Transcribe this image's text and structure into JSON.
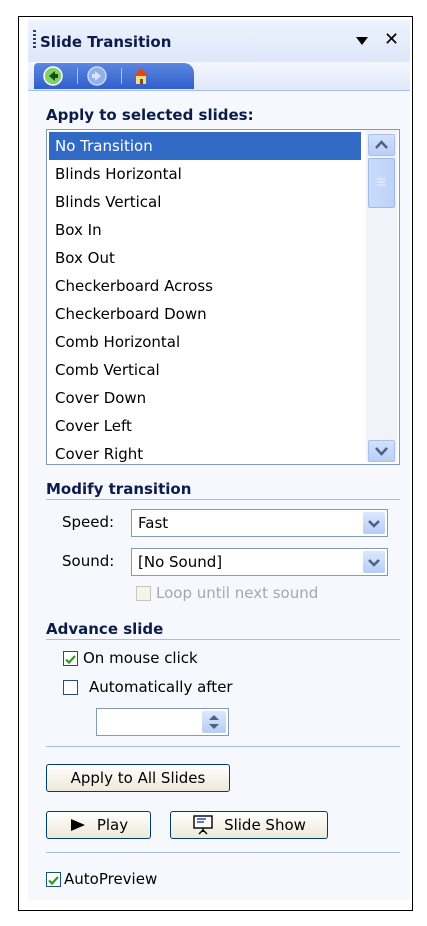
{
  "pane": {
    "title": "Slide Transition"
  },
  "apply_section": {
    "heading": "Apply to selected slides:",
    "items": [
      "No Transition",
      "Blinds Horizontal",
      "Blinds Vertical",
      "Box In",
      "Box Out",
      "Checkerboard Across",
      "Checkerboard Down",
      "Comb Horizontal",
      "Comb Vertical",
      "Cover Down",
      "Cover Left",
      "Cover Right"
    ],
    "selected": "No Transition"
  },
  "modify": {
    "heading": "Modify transition",
    "speed_label": "Speed:",
    "speed_value": "Fast",
    "sound_label": "Sound:",
    "sound_value": "[No Sound]",
    "loop_label": "Loop until next sound",
    "loop_checked": false
  },
  "advance": {
    "heading": "Advance slide",
    "mouse_label": "On mouse click",
    "mouse_checked": true,
    "auto_label": "Automatically after",
    "auto_checked": false,
    "auto_value": ""
  },
  "buttons": {
    "apply_all": "Apply to All Slides",
    "play": "Play",
    "slide_show": "Slide Show"
  },
  "autopreview": {
    "label": "AutoPreview",
    "checked": true
  },
  "colors": {
    "selection": "#316ac5",
    "heading": "#0b1c4a",
    "check": "#21a121"
  }
}
